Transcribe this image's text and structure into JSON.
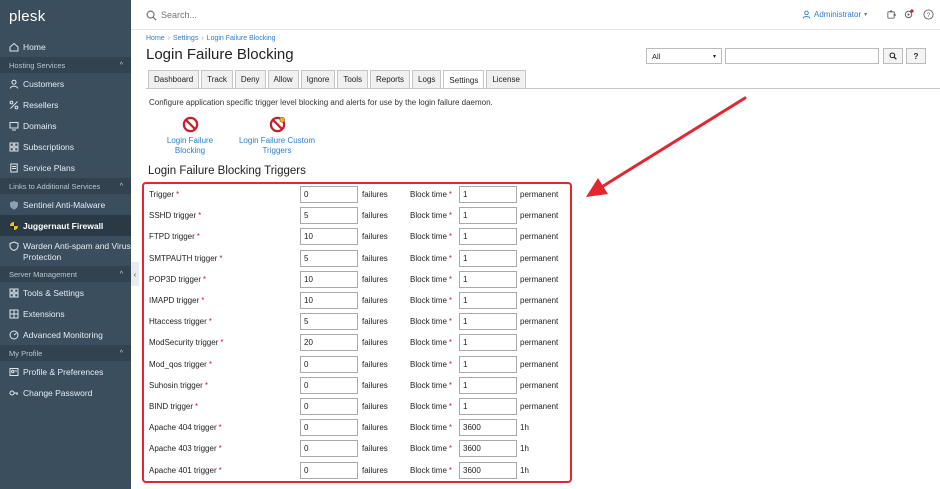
{
  "brand": "plesk",
  "sidebar": {
    "items": [
      {
        "label": "Home",
        "icon": "home-icon"
      },
      {
        "section": "Hosting Services"
      },
      {
        "label": "Customers",
        "icon": "user-icon"
      },
      {
        "label": "Resellers",
        "icon": "percent-icon"
      },
      {
        "label": "Domains",
        "icon": "monitor-icon"
      },
      {
        "label": "Subscriptions",
        "icon": "grid-icon"
      },
      {
        "label": "Service Plans",
        "icon": "document-icon"
      },
      {
        "section": "Links to Additional Services"
      },
      {
        "label": "Sentinel Anti-Malware",
        "icon": "shield-icon"
      },
      {
        "label": "Juggernaut Firewall",
        "icon": "firewall-icon",
        "active": true
      },
      {
        "label": "Warden Anti-spam and Virus Protection",
        "icon": "warden-icon"
      },
      {
        "section": "Server Management"
      },
      {
        "label": "Tools & Settings",
        "icon": "tools-icon"
      },
      {
        "label": "Extensions",
        "icon": "extensions-icon"
      },
      {
        "label": "Advanced Monitoring",
        "icon": "monitoring-icon"
      },
      {
        "section": "My Profile"
      },
      {
        "label": "Profile & Preferences",
        "icon": "profile-icon"
      },
      {
        "label": "Change Password",
        "icon": "key-icon"
      }
    ]
  },
  "topbar": {
    "search_placeholder": "Search...",
    "user": "Administrator"
  },
  "breadcrumbs": [
    "Home",
    "Settings",
    "Login Failure Blocking"
  ],
  "page_title": "Login Failure Blocking",
  "filter": {
    "select_value": "All"
  },
  "tabs": [
    "Dashboard",
    "Track",
    "Deny",
    "Allow",
    "Ignore",
    "Tools",
    "Reports",
    "Logs",
    "Settings",
    "License"
  ],
  "active_tab": "Settings",
  "intro": "Configure application specific trigger level blocking and alerts for use by the login failure daemon.",
  "shortcuts": [
    {
      "line1": "Login Failure",
      "line2": "Blocking"
    },
    {
      "line1": "Login Failure Custom",
      "line2": "Triggers"
    }
  ],
  "section_title": "Login Failure Blocking Triggers",
  "form": {
    "required_mark": "*",
    "unit_failures": "failures",
    "block_time_label": "Block time",
    "rows": [
      {
        "label": "Trigger",
        "value": "0",
        "block": "1",
        "suffix": "permanent"
      },
      {
        "label": "SSHD trigger",
        "value": "5",
        "block": "1",
        "suffix": "permanent"
      },
      {
        "label": "FTPD trigger",
        "value": "10",
        "block": "1",
        "suffix": "permanent"
      },
      {
        "label": "SMTPAUTH trigger",
        "value": "5",
        "block": "1",
        "suffix": "permanent"
      },
      {
        "label": "POP3D trigger",
        "value": "10",
        "block": "1",
        "suffix": "permanent"
      },
      {
        "label": "IMAPD trigger",
        "value": "10",
        "block": "1",
        "suffix": "permanent"
      },
      {
        "label": "Htaccess trigger",
        "value": "5",
        "block": "1",
        "suffix": "permanent"
      },
      {
        "label": "ModSecurity trigger",
        "value": "20",
        "block": "1",
        "suffix": "permanent"
      },
      {
        "label": "Mod_qos trigger",
        "value": "0",
        "block": "1",
        "suffix": "permanent"
      },
      {
        "label": "Suhosin trigger",
        "value": "0",
        "block": "1",
        "suffix": "permanent"
      },
      {
        "label": "BIND trigger",
        "value": "0",
        "block": "1",
        "suffix": "permanent"
      },
      {
        "label": "Apache 404 trigger",
        "value": "0",
        "block": "3600",
        "suffix": "1h"
      },
      {
        "label": "Apache 403 trigger",
        "value": "0",
        "block": "3600",
        "suffix": "1h"
      },
      {
        "label": "Apache 401 trigger",
        "value": "0",
        "block": "3600",
        "suffix": "1h"
      }
    ]
  },
  "colors": {
    "sidebar_bg": "#3b4e5e",
    "link": "#2a7dd2",
    "highlight": "#e5262e"
  }
}
